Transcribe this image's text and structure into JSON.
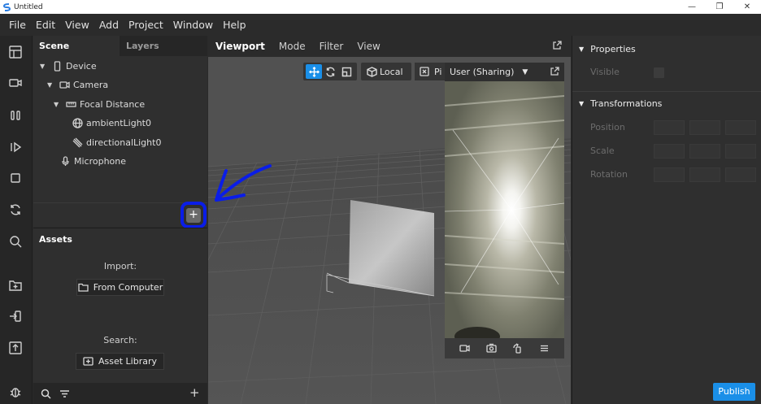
{
  "window": {
    "title": "Untitled",
    "controls": [
      "—",
      "❐",
      "✕"
    ]
  },
  "menubar": [
    "File",
    "Edit",
    "View",
    "Add",
    "Project",
    "Window",
    "Help"
  ],
  "scene_panel": {
    "tabs": [
      "Scene",
      "Layers"
    ],
    "tree": [
      {
        "label": "Device",
        "icon": "phone-icon"
      },
      {
        "label": "Camera",
        "icon": "camera-icon"
      },
      {
        "label": "Focal Distance",
        "icon": "focal-distance-icon"
      },
      {
        "label": "ambientLight0",
        "icon": "globe-icon"
      },
      {
        "label": "directionalLight0",
        "icon": "directional-light-icon"
      },
      {
        "label": "Microphone",
        "icon": "microphone-icon"
      }
    ],
    "add_button": "+"
  },
  "assets_panel": {
    "title": "Assets",
    "import_label": "Import:",
    "from_computer": "From Computer",
    "search_label": "Search:",
    "asset_library": "Asset Library",
    "add_button": "+"
  },
  "viewport": {
    "tabs": [
      "Viewport",
      "Mode",
      "Filter",
      "View"
    ],
    "local_label": "Local",
    "mode_pill_label": "Pi"
  },
  "preview": {
    "title": "User (Sharing)"
  },
  "properties": {
    "properties_title": "Properties",
    "visible_label": "Visible",
    "transformations_title": "Transformations",
    "position_label": "Position",
    "scale_label": "Scale",
    "rotation_label": "Rotation",
    "publish_label": "Publish"
  },
  "colors": {
    "accent": "#1a8fe8",
    "annotation": "#0a1de8"
  }
}
